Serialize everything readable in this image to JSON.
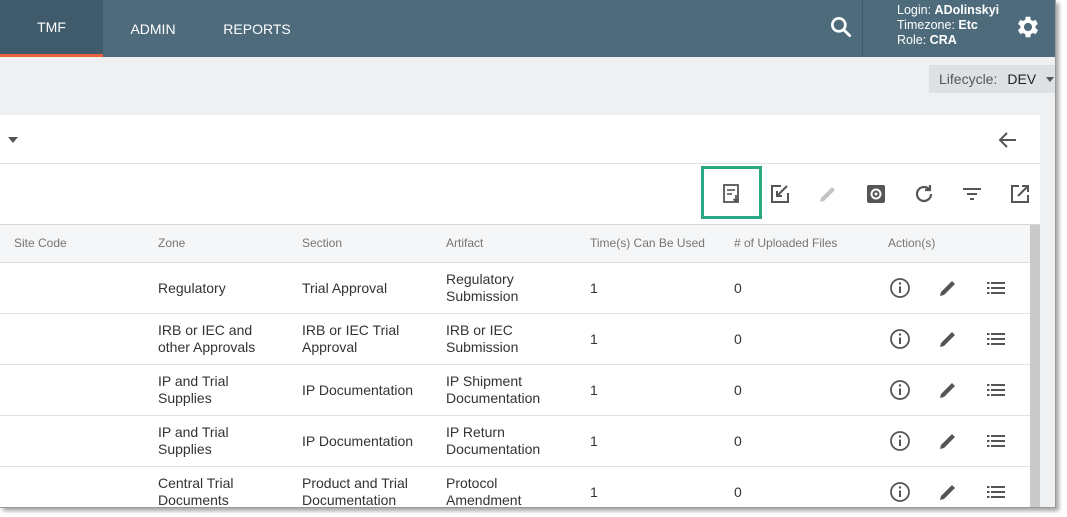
{
  "nav": {
    "tabs": [
      {
        "label": "TMF",
        "active": true
      },
      {
        "label": "ADMIN",
        "active": false
      },
      {
        "label": "REPORTS",
        "active": false
      }
    ],
    "search_icon": "search-icon",
    "user": {
      "login_label": "Login:",
      "login_value": "ADolinskyi",
      "timezone_label": "Timezone:",
      "timezone_value": "Etc",
      "role_label": "Role:",
      "role_value": "CRA"
    },
    "settings_icon": "gear-icon"
  },
  "lifecycle": {
    "label": "Lifecycle:",
    "value": "DEV"
  },
  "toolbar": {
    "icons": [
      "export-list-icon",
      "edit-checkbox-icon",
      "pencil-icon",
      "settings-icon",
      "refresh-icon",
      "filter-icon",
      "open-external-icon"
    ],
    "highlight_color": "#2aa884"
  },
  "table": {
    "headers": [
      "Site Code",
      "Zone",
      "Section",
      "Artifact",
      "Time(s) Can Be Used",
      "# of Uploaded Files",
      "Action(s)"
    ],
    "rows": [
      {
        "zone": [
          "Regulatory",
          ""
        ],
        "section": [
          "Trial Approval",
          ""
        ],
        "artifact": [
          "Regulatory",
          "Submission"
        ],
        "times": "1",
        "files": "0"
      },
      {
        "zone": [
          "IRB or IEC and",
          "other Approvals"
        ],
        "section": [
          "IRB or IEC Trial",
          "Approval"
        ],
        "artifact": [
          "IRB or IEC",
          "Submission"
        ],
        "times": "1",
        "files": "0"
      },
      {
        "zone": [
          "IP and Trial",
          "Supplies"
        ],
        "section": [
          "IP Documentation",
          ""
        ],
        "artifact": [
          "IP Shipment",
          "Documentation"
        ],
        "times": "1",
        "files": "0"
      },
      {
        "zone": [
          "IP and Trial",
          "Supplies"
        ],
        "section": [
          "IP Documentation",
          ""
        ],
        "artifact": [
          "IP Return",
          "Documentation"
        ],
        "times": "1",
        "files": "0"
      },
      {
        "zone": [
          "Central Trial",
          "Documents"
        ],
        "section": [
          "Product and Trial",
          "Documentation"
        ],
        "artifact": [
          "Protocol",
          "Amendment"
        ],
        "times": "1",
        "files": "0"
      }
    ],
    "action_icons": [
      "info-icon",
      "pencil-icon",
      "list-icon"
    ]
  },
  "colors": {
    "topbar": "#4e6b7c",
    "active_tab": "#3f5a6a",
    "accent": "#e8643c"
  }
}
